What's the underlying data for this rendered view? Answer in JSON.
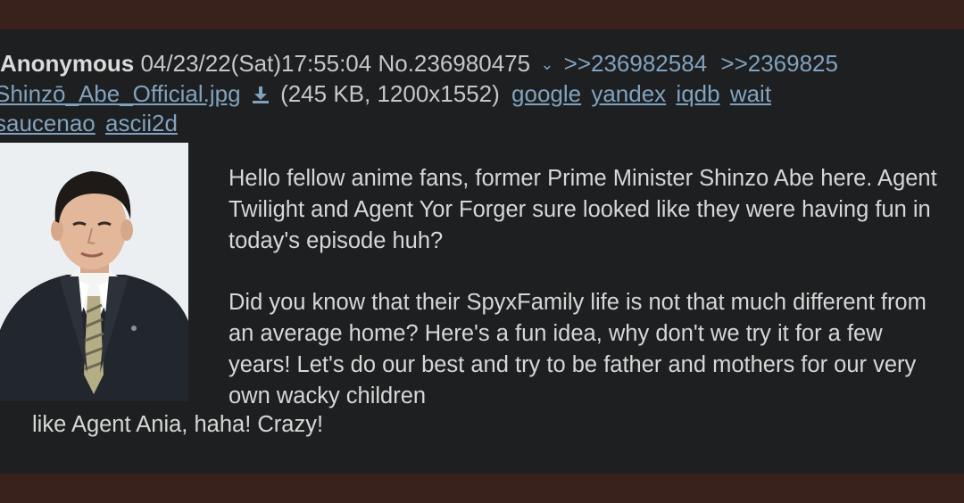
{
  "post": {
    "name": "Anonymous",
    "date": "04/23/22(Sat)17:55:04",
    "post_number": "No.236980475",
    "backlinks": [
      ">>236982584",
      ">>2369825"
    ]
  },
  "file": {
    "filename": "Shinzō_Abe_Official.jpg",
    "info": "(245 KB, 1200x1552)",
    "search_links": [
      "google",
      "yandex",
      "iqdb",
      "wait",
      "saucenao",
      "ascii2d"
    ]
  },
  "message": {
    "paragraph1": "Hello fellow anime fans, former Prime Minister Shinzo Abe here. Agent Twilight and Agent Yor Forger sure looked like they were having fun in today's episode huh?",
    "paragraph2": "Did you know that their SpyxFamily life is not that much different from an average home? Here's a fun idea, why don't we try it for a few years! Let's do our best and try to be father and mothers for our very own wacky children",
    "last_line": "like Agent Ania, haha! Crazy!"
  },
  "icons": {
    "download": "download-icon",
    "chevron": "chevron-down-icon"
  },
  "colors": {
    "link": "#81a2be",
    "post_background": "#1d1f21",
    "text": "#c5c8c6",
    "frame": "#3a221c"
  }
}
